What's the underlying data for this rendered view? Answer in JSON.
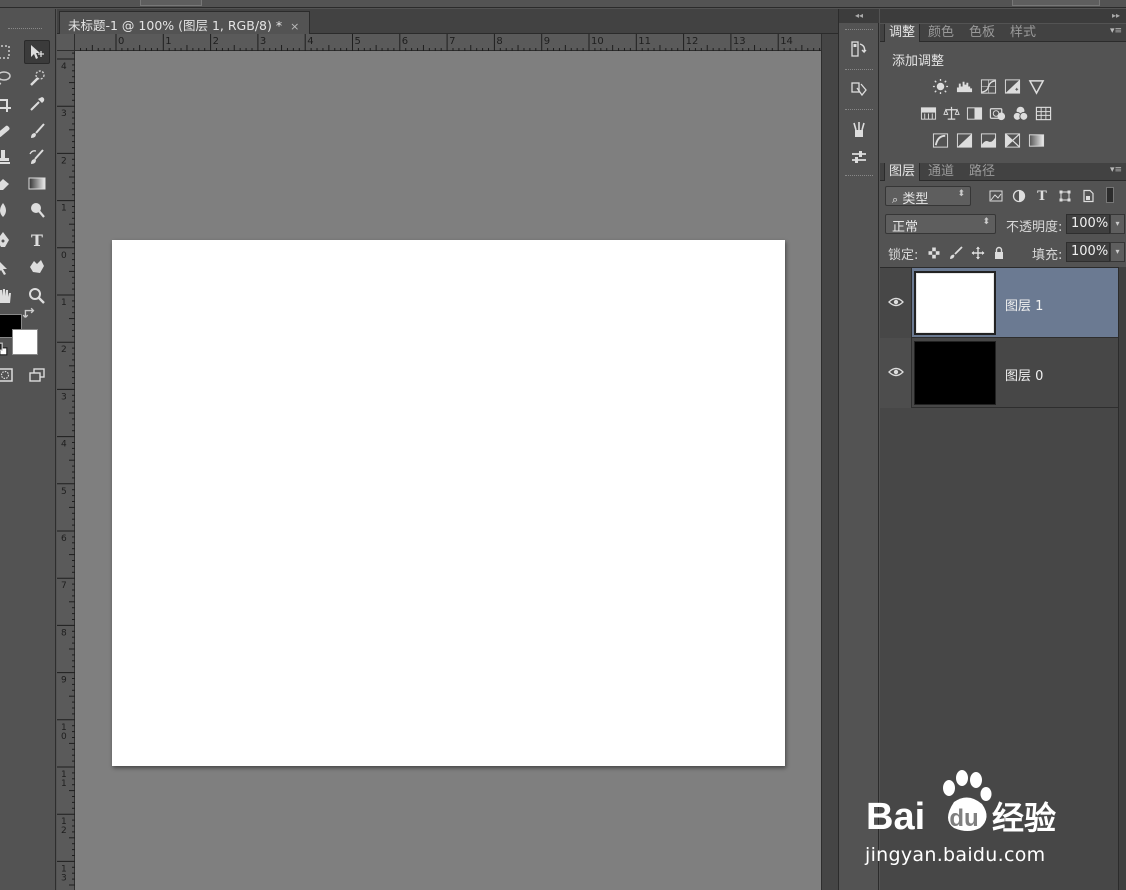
{
  "document": {
    "tab_title": "未标题-1 @ 100% (图层 1, RGB/8) *",
    "close_glyph": "×"
  },
  "rulers": {
    "horizontal_labels": [
      "0",
      "1",
      "2",
      "3",
      "4",
      "5",
      "6",
      "7",
      "8",
      "9",
      "10",
      "11",
      "12",
      "13",
      "14"
    ],
    "vertical_labels": [
      "4",
      "3",
      "2",
      "1",
      "0",
      "1",
      "2",
      "3",
      "4",
      "5",
      "6",
      "7",
      "8",
      "9",
      "10",
      "11",
      "12",
      "13"
    ]
  },
  "adjust_panel": {
    "tabs": [
      "调整",
      "颜色",
      "色板",
      "样式"
    ],
    "active_tab": "调整",
    "title": "添加调整"
  },
  "layers_panel": {
    "tabs": [
      "图层",
      "通道",
      "路径"
    ],
    "active_tab": "图层",
    "filter_kind": "类型",
    "blend_mode": "正常",
    "opacity_label": "不透明度:",
    "opacity_value": "100%",
    "lock_label": "锁定:",
    "fill_label": "填充:",
    "fill_value": "100%",
    "layers": [
      {
        "name": "图层 1",
        "thumb": "white",
        "selected": true
      },
      {
        "name": "图层 0",
        "thumb": "black",
        "selected": false
      }
    ]
  },
  "toolbox": {
    "text_tool_glyph": "T",
    "foreground_color": "#000000",
    "background_color": "#ffffff"
  },
  "colors": {
    "ui_bg": "#535353",
    "pasteboard": "#7f7f7f",
    "selected_layer": "#6b7a92"
  },
  "watermark": {
    "text": "jingyan.baidu.com",
    "logo_text": "Baidu经验"
  }
}
